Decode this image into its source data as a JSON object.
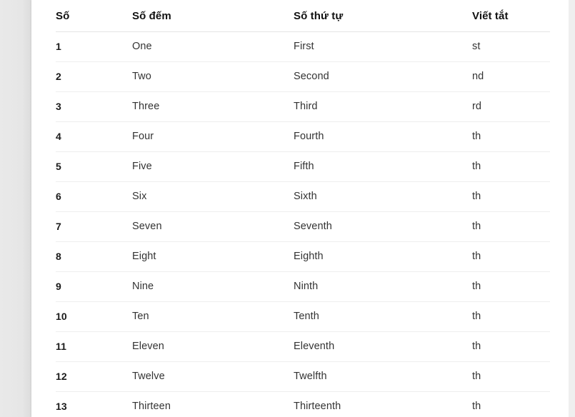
{
  "table": {
    "headers": [
      "Số",
      "Số đếm",
      "Số thứ tự",
      "Viết tắt"
    ],
    "rows": [
      {
        "number": "1",
        "cardinal": "One",
        "ordinal": "First",
        "suffix": "st"
      },
      {
        "number": "2",
        "cardinal": "Two",
        "ordinal": "Second",
        "suffix": "nd"
      },
      {
        "number": "3",
        "cardinal": "Three",
        "ordinal": "Third",
        "suffix": "rd"
      },
      {
        "number": "4",
        "cardinal": "Four",
        "ordinal": "Fourth",
        "suffix": "th"
      },
      {
        "number": "5",
        "cardinal": "Five",
        "ordinal": "Fifth",
        "suffix": "th"
      },
      {
        "number": "6",
        "cardinal": "Six",
        "ordinal": "Sixth",
        "suffix": "th"
      },
      {
        "number": "7",
        "cardinal": "Seven",
        "ordinal": "Seventh",
        "suffix": "th"
      },
      {
        "number": "8",
        "cardinal": "Eight",
        "ordinal": "Eighth",
        "suffix": "th"
      },
      {
        "number": "9",
        "cardinal": "Nine",
        "ordinal": "Ninth",
        "suffix": "th"
      },
      {
        "number": "10",
        "cardinal": "Ten",
        "ordinal": "Tenth",
        "suffix": "th"
      },
      {
        "number": "11",
        "cardinal": "Eleven",
        "ordinal": "Eleventh",
        "suffix": "th"
      },
      {
        "number": "12",
        "cardinal": "Twelve",
        "ordinal": "Twelfth",
        "suffix": "th"
      },
      {
        "number": "13",
        "cardinal": "Thirteen",
        "ordinal": "Thirteenth",
        "suffix": "th"
      }
    ]
  },
  "colors": {
    "page_background": "#ebebeb",
    "card_background": "#ffffff",
    "header_text": "#111111",
    "body_text": "#333333",
    "row_divider": "#eeeeee",
    "scrollbar_track": "#efefef"
  }
}
